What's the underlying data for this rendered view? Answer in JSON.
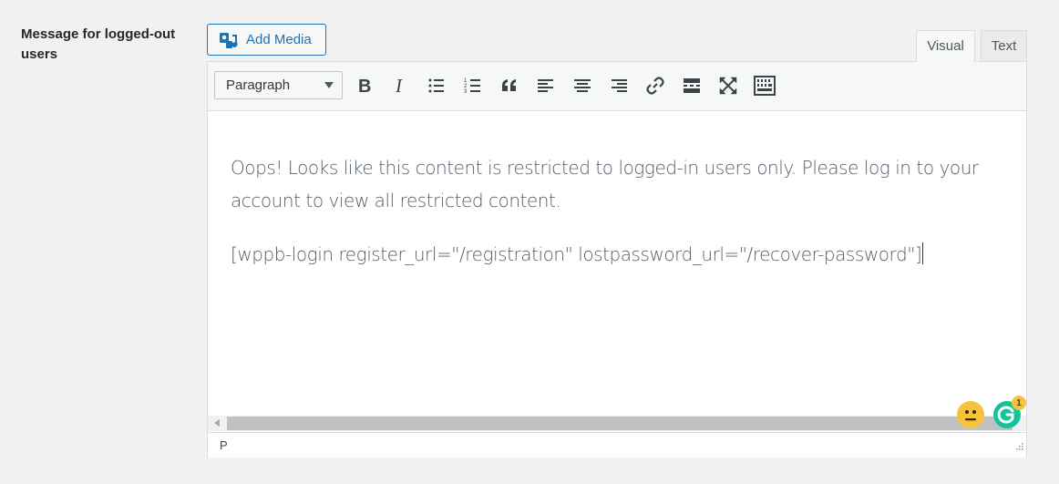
{
  "field": {
    "label": "Message for logged-out users"
  },
  "media": {
    "add_label": "Add Media"
  },
  "tabs": {
    "visual": "Visual",
    "text": "Text"
  },
  "toolbar": {
    "format_value": "Paragraph",
    "buttons": [
      "bold",
      "italic",
      "bulleted-list",
      "numbered-list",
      "blockquote",
      "align-left",
      "align-center",
      "align-right",
      "insert-link",
      "read-more",
      "fullscreen",
      "toolbar-toggle"
    ]
  },
  "content": {
    "paragraph1": "Oops! Looks like this content is restricted to logged-in users only. Please log in to your account to view all restricted content.",
    "paragraph2": "[wppb-login register_url=\"/registration\" lostpassword_url=\"/recover-password\"]"
  },
  "status": {
    "path": "P"
  },
  "grammarly": {
    "badge_count": "1"
  },
  "colors": {
    "accent": "#2271b1",
    "grammarly": "#15c39a",
    "emoji": "#f7c33b"
  }
}
